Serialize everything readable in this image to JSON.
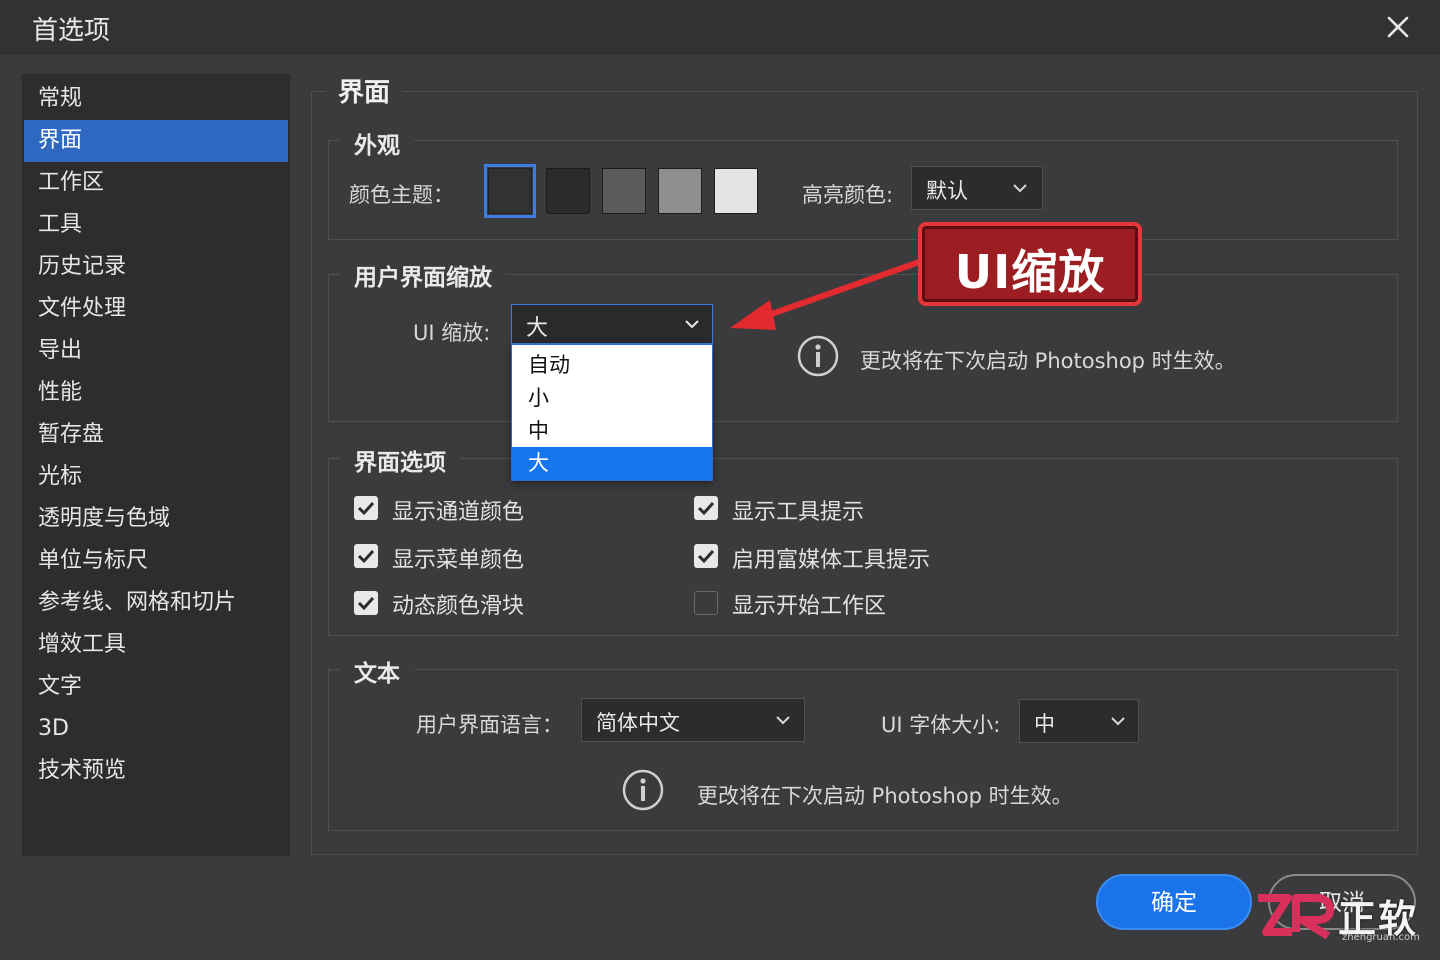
{
  "dialog": {
    "title": "首选项"
  },
  "sidebar": {
    "items": [
      {
        "label": "常规",
        "active": false
      },
      {
        "label": "界面",
        "active": true
      },
      {
        "label": "工作区",
        "active": false
      },
      {
        "label": "工具",
        "active": false
      },
      {
        "label": "历史记录",
        "active": false
      },
      {
        "label": "文件处理",
        "active": false
      },
      {
        "label": "导出",
        "active": false
      },
      {
        "label": "性能",
        "active": false
      },
      {
        "label": "暂存盘",
        "active": false
      },
      {
        "label": "光标",
        "active": false
      },
      {
        "label": "透明度与色域",
        "active": false
      },
      {
        "label": "单位与标尺",
        "active": false
      },
      {
        "label": "参考线、网格和切片",
        "active": false
      },
      {
        "label": "增效工具",
        "active": false
      },
      {
        "label": "文字",
        "active": false
      },
      {
        "label": "3D",
        "active": false
      },
      {
        "label": "技术预览",
        "active": false
      }
    ]
  },
  "main": {
    "title": "界面",
    "appearance": {
      "title": "外观",
      "color_theme_label": "颜色主题：",
      "themes": [
        {
          "color": "#323234",
          "selected": true
        },
        {
          "color": "#2b2b2b",
          "selected": false
        },
        {
          "color": "#5a5a5c",
          "selected": false
        },
        {
          "color": "#8e8e90",
          "selected": false
        },
        {
          "color": "#e3e3e3",
          "selected": false
        }
      ],
      "highlight_label": "高亮颜色:",
      "highlight_value": "默认"
    },
    "ui_scaling": {
      "title": "用户界面缩放",
      "label": "UI 缩放:",
      "value": "大",
      "options": [
        {
          "label": "自动",
          "selected": false
        },
        {
          "label": "小",
          "selected": false
        },
        {
          "label": "中",
          "selected": false
        },
        {
          "label": "大",
          "selected": true
        }
      ],
      "note": "更改将在下次启动 Photoshop 时生效。"
    },
    "interface_options": {
      "title": "界面选项",
      "checkboxes": [
        {
          "label": "显示通道颜色",
          "checked": true
        },
        {
          "label": "显示工具提示",
          "checked": true
        },
        {
          "label": "显示菜单颜色",
          "checked": true
        },
        {
          "label": "启用富媒体工具提示",
          "checked": true
        },
        {
          "label": "动态颜色滑块",
          "checked": true
        },
        {
          "label": "显示开始工作区",
          "checked": false
        }
      ]
    },
    "text": {
      "title": "文本",
      "language_label": "用户界面语言：",
      "language_value": "简体中文",
      "font_size_label": "UI 字体大小:",
      "font_size_value": "中",
      "note": "更改将在下次启动 Photoshop 时生效。"
    }
  },
  "annotation": {
    "label": "UI缩放",
    "color": "#9c1d22"
  },
  "buttons": {
    "ok": "确定",
    "cancel": "取消"
  },
  "watermark": {
    "name": "正软",
    "url": "zhengruan.com"
  }
}
